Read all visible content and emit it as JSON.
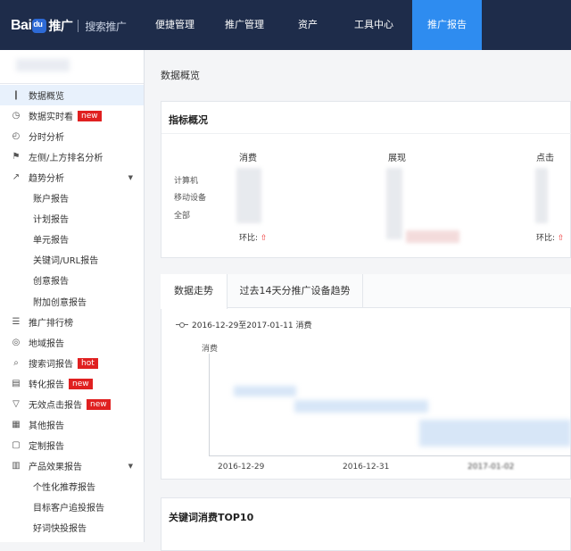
{
  "header": {
    "brand_left": "Bai",
    "brand_right": "推广",
    "product": "搜索推广",
    "nav": [
      {
        "label": "便捷管理",
        "active": false
      },
      {
        "label": "推广管理",
        "active": false
      },
      {
        "label": "资产",
        "active": false
      },
      {
        "label": "工具中心",
        "active": false
      },
      {
        "label": "推广报告",
        "active": true
      }
    ]
  },
  "sidebar": {
    "items": [
      {
        "label": "数据概览",
        "icon": "bar-chart-icon",
        "active": true
      },
      {
        "label": "数据实时看",
        "icon": "stopwatch-icon",
        "badge": "new"
      },
      {
        "label": "分时分析",
        "icon": "clock-icon"
      },
      {
        "label": "左侧/上方排名分析",
        "icon": "trophy-icon"
      },
      {
        "label": "趋势分析",
        "icon": "line-chart-icon",
        "expanded": true
      },
      {
        "label": "账户报告",
        "sub": true
      },
      {
        "label": "计划报告",
        "sub": true
      },
      {
        "label": "单元报告",
        "sub": true
      },
      {
        "label": "关键词/URL报告",
        "sub": true
      },
      {
        "label": "创意报告",
        "sub": true
      },
      {
        "label": "附加创意报告",
        "sub": true
      },
      {
        "label": "推广排行榜",
        "icon": "ranking-list-icon"
      },
      {
        "label": "地域报告",
        "icon": "globe-icon"
      },
      {
        "label": "搜索词报告",
        "icon": "search-icon",
        "badge": "hot"
      },
      {
        "label": "转化报告",
        "icon": "clipboard-icon",
        "badge": "new"
      },
      {
        "label": "无效点击报告",
        "icon": "filter-icon",
        "badge": "new"
      },
      {
        "label": "其他报告",
        "icon": "grid-icon"
      },
      {
        "label": "定制报告",
        "icon": "edit-icon"
      },
      {
        "label": "产品效果报告",
        "icon": "document-icon",
        "expanded": true
      },
      {
        "label": "个性化推荐报告",
        "sub": true
      },
      {
        "label": "目标客户追投报告",
        "sub": true
      },
      {
        "label": "好词快投报告",
        "sub": true
      }
    ]
  },
  "main": {
    "page_title": "数据概览",
    "metrics_card": {
      "title": "指标概况",
      "columns": [
        "消费",
        "展现",
        "点击"
      ],
      "rows": [
        "计算机",
        "移动设备",
        "全部"
      ],
      "ratio_label": "环比:"
    },
    "tabs": [
      {
        "label": "数据走势",
        "active": true
      },
      {
        "label": "过去14天分推广设备趋势",
        "active": false
      }
    ],
    "chart": {
      "legend": "2016-12-29至2017-01-11 消费",
      "ylabel": "消费",
      "x_ticks": [
        "2016-12-29",
        "2016-12-31",
        "2017-01-02"
      ]
    },
    "top10_title": "关键词消费TOP10"
  },
  "colors": {
    "header_bg": "#1e2c4a",
    "nav_active": "#2e8cf0",
    "badge_red": "#e02020",
    "sidebar_active": "#e8f1fc"
  }
}
